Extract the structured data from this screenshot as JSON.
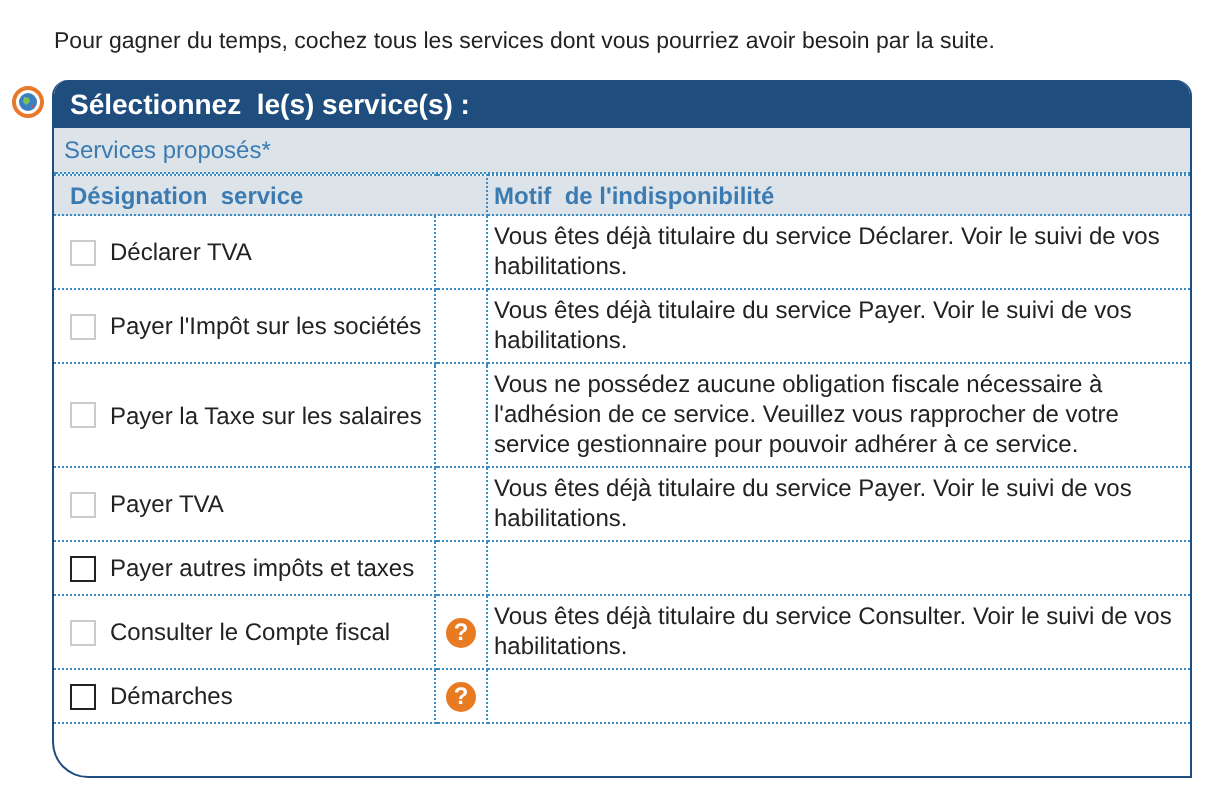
{
  "intro": "Pour gagner du temps, cochez tous les services dont vous pourriez avoir besoin par la suite.",
  "panel": {
    "title": "Sélectionnez  le(s) service(s) :",
    "subtitle": "Services proposés*"
  },
  "table": {
    "columns": [
      "Désignation  service",
      "Motif  de l'indisponibilité"
    ],
    "rows": [
      {
        "service": "Déclarer TVA",
        "disabled": true,
        "checked": false,
        "reason": "Vous êtes déjà titulaire du service Déclarer. Voir le suivi de vos habilitations."
      },
      {
        "service": "Payer l'Impôt sur les sociétés",
        "disabled": true,
        "checked": false,
        "reason": "Vous êtes déjà titulaire du service Payer. Voir le suivi de vos habilitations."
      },
      {
        "service": "Payer la Taxe sur les salaires",
        "disabled": true,
        "checked": false,
        "reason": "Vous ne possédez aucune obligation fiscale nécessaire à l'adhésion de ce service. Veuillez vous rapprocher de votre service gestionnaire pour pouvoir adhérer à ce service."
      },
      {
        "service": "Payer TVA",
        "disabled": true,
        "checked": false,
        "reason": "Vous êtes déjà titulaire du service Payer. Voir le suivi de vos habilitations."
      },
      {
        "service": "Payer autres impôts et taxes",
        "disabled": false,
        "checked": false
      },
      {
        "service": "Consulter le Compte fiscal",
        "disabled": true,
        "checked": false,
        "help": "?",
        "reason": "Vous êtes déjà titulaire du service Consulter. Voir le suivi de vos habilitations."
      },
      {
        "service": "Démarches",
        "disabled": false,
        "checked": false,
        "help": "?"
      }
    ]
  }
}
